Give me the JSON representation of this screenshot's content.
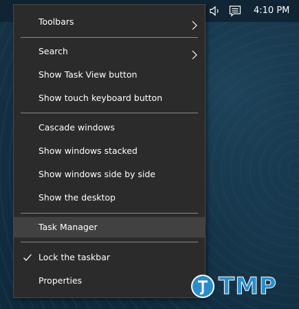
{
  "taskbar": {
    "clock": "4:10 PM",
    "icons": [
      "volume-icon",
      "notification-icon"
    ]
  },
  "menu": {
    "items": [
      {
        "label": "Toolbars",
        "submenu": true
      },
      {
        "label": "Search",
        "submenu": true
      },
      {
        "label": "Show Task View button"
      },
      {
        "label": "Show touch keyboard button"
      },
      {
        "label": "Cascade windows"
      },
      {
        "label": "Show windows stacked"
      },
      {
        "label": "Show windows side by side"
      },
      {
        "label": "Show the desktop"
      },
      {
        "label": "Task Manager",
        "highlighted": true
      },
      {
        "label": "Lock the taskbar",
        "checked": true
      },
      {
        "label": "Properties"
      }
    ]
  },
  "watermark": {
    "text": "TMP"
  },
  "colors": {
    "menu_background": "#2b2b2b",
    "menu_highlight": "#414141",
    "watermark_blue": "#2a8cc9"
  }
}
